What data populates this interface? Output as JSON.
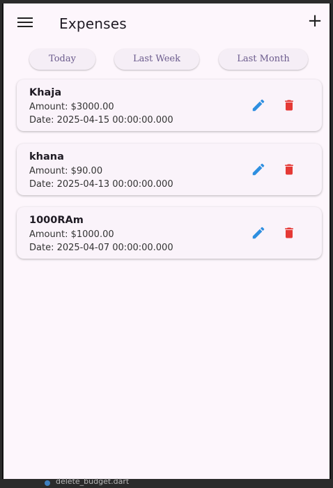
{
  "appbar": {
    "title": "Expenses"
  },
  "filters": [
    "Today",
    "Last Week",
    "Last Month"
  ],
  "expenses": [
    {
      "name": "Khaja",
      "amount": "Amount: $3000.00",
      "date": "Date: 2025-04-15 00:00:00.000"
    },
    {
      "name": "khana",
      "amount": "Amount: $90.00",
      "date": "Date: 2025-04-13 00:00:00.000"
    },
    {
      "name": "1000RAm",
      "amount": "Amount: $1000.00",
      "date": "Date: 2025-04-07 00:00:00.000"
    }
  ],
  "taskbar": {
    "file": "delete_budget.dart"
  },
  "colors": {
    "edit": "#2e8fe0",
    "delete": "#e53935",
    "background": "#fdf6fc",
    "chip_text": "#6a5a8c"
  },
  "icons": {
    "menu": "menu-icon",
    "add": "add-icon",
    "edit": "edit-icon",
    "delete": "delete-icon"
  }
}
